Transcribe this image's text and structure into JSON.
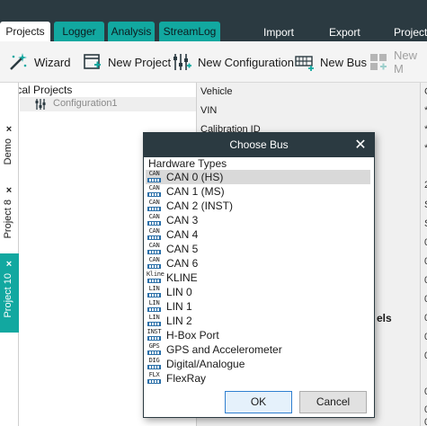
{
  "tabs": [
    {
      "label": "Projects",
      "active": true
    },
    {
      "label": "Logger",
      "active": false
    },
    {
      "label": "Analysis",
      "active": false
    },
    {
      "label": "StreamLog",
      "active": false
    }
  ],
  "menu": [
    "Import",
    "Export",
    "Project"
  ],
  "toolbar": {
    "wizard": "Wizard",
    "new_project": "New Project",
    "new_configuration": "New Configuration",
    "new_bus": "New Bus",
    "new_m": "New M"
  },
  "side_tabs": [
    "Demo",
    "Project 8",
    "Project 10"
  ],
  "projects": {
    "title": "Local Projects",
    "configuration": "Configuration1"
  },
  "properties": [
    "Vehicle",
    "VIN",
    "Calibration ID"
  ],
  "property_markers": [
    "C",
    "*",
    "*",
    "*",
    "2",
    "S",
    "S",
    "0",
    "0",
    "0",
    "0",
    "0",
    "0",
    "0",
    "0",
    "0",
    "0"
  ],
  "fragment_text": "els",
  "dialog": {
    "title": "Choose Bus",
    "heading": "Hardware Types",
    "items": [
      {
        "icon": "CAN",
        "label": "CAN 0 (HS)",
        "selected": true
      },
      {
        "icon": "CAN",
        "label": "CAN 1 (MS)"
      },
      {
        "icon": "CAN",
        "label": "CAN 2 (INST)"
      },
      {
        "icon": "CAN",
        "label": "CAN 3"
      },
      {
        "icon": "CAN",
        "label": "CAN 4"
      },
      {
        "icon": "CAN",
        "label": "CAN 5"
      },
      {
        "icon": "CAN",
        "label": "CAN 6"
      },
      {
        "icon": "Kline",
        "label": "KLINE"
      },
      {
        "icon": "LIN",
        "label": "LIN 0"
      },
      {
        "icon": "LIN",
        "label": "LIN 1"
      },
      {
        "icon": "LIN",
        "label": "LIN 2"
      },
      {
        "icon": "INST",
        "label": "H-Box Port"
      },
      {
        "icon": "GPS",
        "label": "GPS and Accelerometer"
      },
      {
        "icon": "DIG",
        "label": "Digital/Analogue"
      },
      {
        "icon": "FLX",
        "label": "FlexRay"
      }
    ],
    "ok_label": "OK",
    "cancel_label": "Cancel"
  }
}
